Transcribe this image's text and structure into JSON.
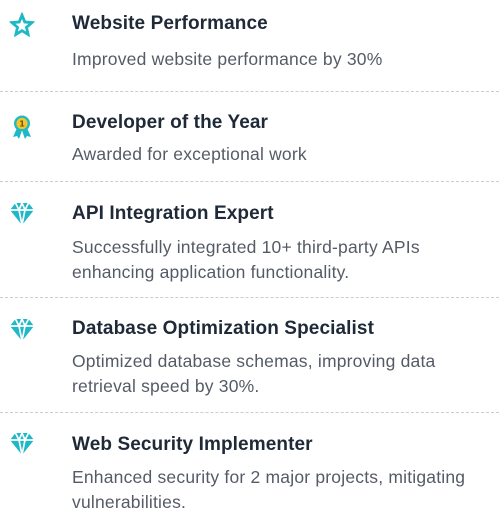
{
  "achievements": [
    {
      "icon": "star-icon",
      "title": "Website Performance",
      "description": "Improved website performance by 30%"
    },
    {
      "icon": "award-medal-icon",
      "title": "Developer of the Year",
      "description": "Awarded for exceptional work"
    },
    {
      "icon": "diamond-icon",
      "title": "API Integration Expert",
      "description": "Successfully integrated 10+ third-party APIs enhancing application functionality."
    },
    {
      "icon": "diamond-icon",
      "title": "Database Optimization Specialist",
      "description": "Optimized database schemas, improving data retrieval speed by 30%."
    },
    {
      "icon": "diamond-icon",
      "title": "Web Security Implementer",
      "description": "Enhanced security for 2 major projects, mitigating vulnerabilities."
    }
  ],
  "colors": {
    "accent": "#1fb8c7",
    "title": "#1f2937",
    "text": "#555b66",
    "divider": "#c9ccd1"
  }
}
